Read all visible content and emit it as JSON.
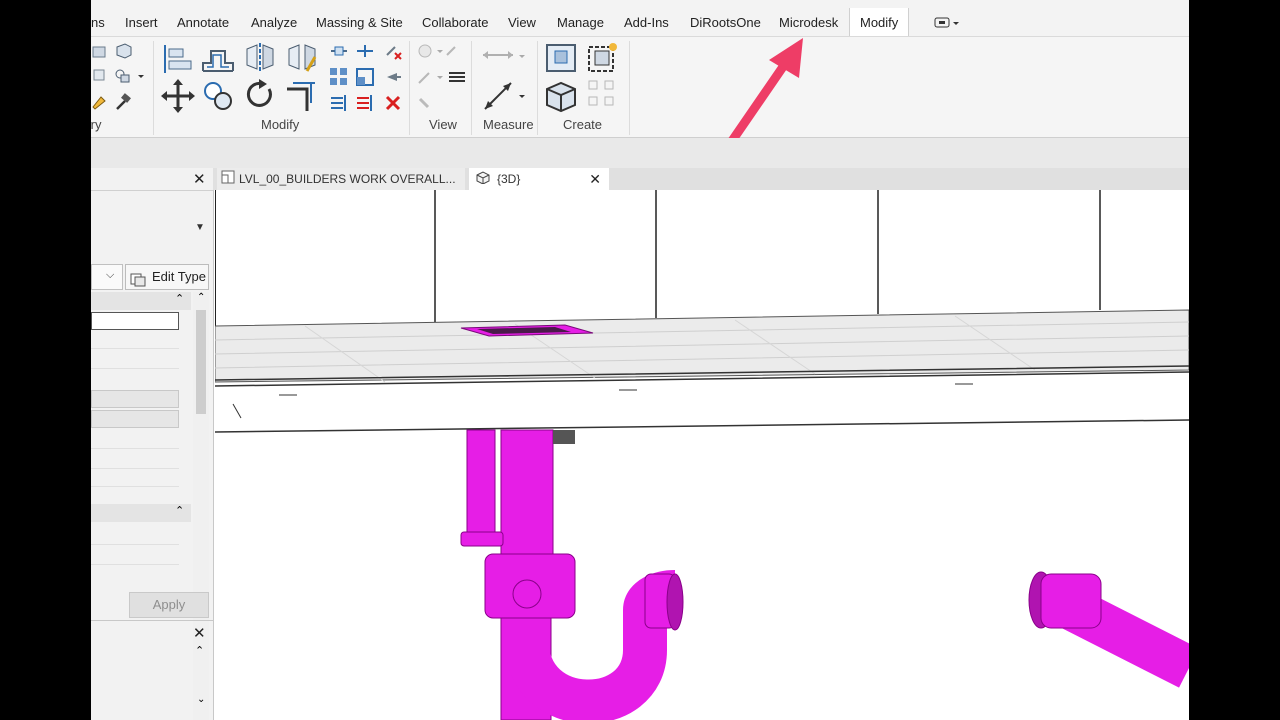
{
  "ribbon_tabs": [
    {
      "label": "ns"
    },
    {
      "label": "Insert"
    },
    {
      "label": "Annotate"
    },
    {
      "label": "Analyze"
    },
    {
      "label": "Massing & Site"
    },
    {
      "label": "Collaborate"
    },
    {
      "label": "View"
    },
    {
      "label": "Manage"
    },
    {
      "label": "Add-Ins"
    },
    {
      "label": "DiRootsOne"
    },
    {
      "label": "Microdesk"
    },
    {
      "label": "Modify"
    }
  ],
  "ribbon_groups": {
    "geometry_partial": "try",
    "modify": "Modify",
    "view": "View",
    "measure": "Measure",
    "create": "Create"
  },
  "properties": {
    "edit_type": "Edit Type",
    "apply": "Apply"
  },
  "view_tabs": [
    {
      "label": "LVL_00_BUILDERS WORK OVERALL..."
    },
    {
      "label": "{3D}"
    }
  ],
  "colors": {
    "pipe": "#e61ee6",
    "annotation_arrow": "#ee3d66",
    "ribbon_bg": "#f5f5f5",
    "active_tab": "#ffffff"
  },
  "icons": [
    "align-icon",
    "offset-icon",
    "mirror-pick-axis-icon",
    "mirror-draw-axis-icon",
    "move-icon",
    "copy-icon",
    "rotate-icon",
    "trim-icon",
    "split-icon",
    "array-icon",
    "scale-icon",
    "pin-icon",
    "unpin-icon",
    "delete-icon",
    "measure-icon",
    "create-assembly-icon",
    "create-similar-icon",
    "create-group-icon",
    "create-parts-icon"
  ]
}
